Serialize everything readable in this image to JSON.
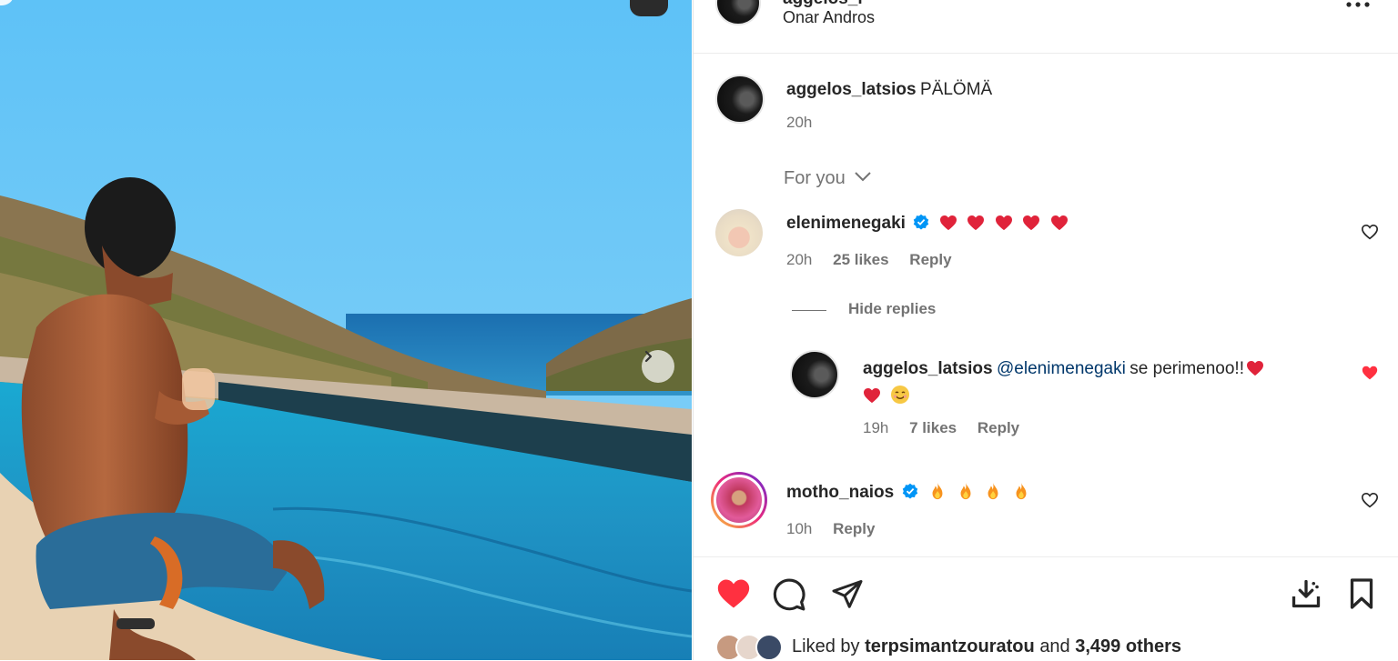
{
  "header": {
    "username_partial": "aggelos_l",
    "location": "Onar Andros",
    "more_icon": "more-horizontal-icon"
  },
  "caption": {
    "username": "aggelos_latsios",
    "text": "PÄLÖMÄ",
    "time": "20h"
  },
  "sort": {
    "label": "For you",
    "icon": "chevron-down-icon"
  },
  "comments": [
    {
      "username": "elenimenegaki",
      "verified": true,
      "emoji": "❤️❤️❤️❤️❤️",
      "time": "20h",
      "likes": "25 likes",
      "reply": "Reply",
      "hide_replies": "Hide replies",
      "liked": false
    },
    {
      "username": "aggelos_latsios",
      "mention": "@elenimenegaki",
      "text": "se perimenoo!!",
      "emoji": "❤️❤️😊",
      "time": "19h",
      "likes": "7 likes",
      "reply": "Reply",
      "liked": true
    },
    {
      "username": "motho_naios",
      "verified": true,
      "emoji": "🔥🔥🔥🔥",
      "time": "10h",
      "reply": "Reply",
      "liked": false
    }
  ],
  "actions": {
    "like": "heart-filled-icon",
    "comment": "comment-icon",
    "share": "share-icon",
    "download": "download-icon",
    "save": "bookmark-icon"
  },
  "likes_summary": {
    "prefix": "Liked by",
    "user": "terpsimantzouratou",
    "and": "and",
    "others": "3,499 others"
  },
  "colors": {
    "heart_red": "#ff3040",
    "verified_blue": "#0095f6",
    "fire_orange": "#f7931e",
    "link_blue": "#00376b",
    "meta_grey": "#737373"
  }
}
